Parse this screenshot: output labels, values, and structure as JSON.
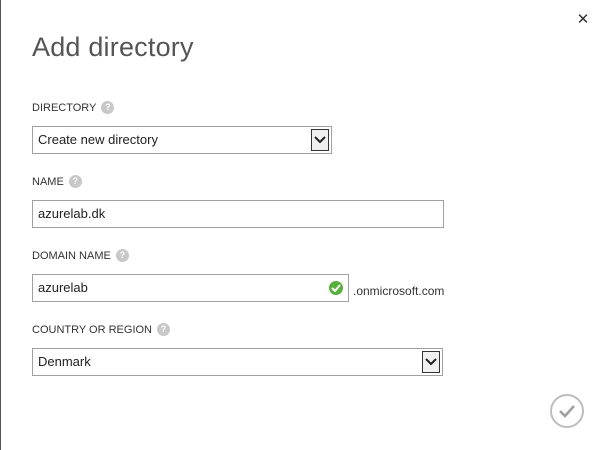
{
  "dialog": {
    "title": "Add directory",
    "close_icon": "close-icon",
    "confirm_icon": "checkmark-icon"
  },
  "directory": {
    "label": "DIRECTORY",
    "help": "?",
    "selected": "Create new directory"
  },
  "name": {
    "label": "NAME",
    "help": "?",
    "value": "azurelab.dk"
  },
  "domain": {
    "label": "DOMAIN NAME",
    "help": "?",
    "value": "azurelab",
    "suffix": ".onmicrosoft.com",
    "status_icon": "valid-check-icon"
  },
  "country": {
    "label": "COUNTRY OR REGION",
    "help": "?",
    "selected": "Denmark"
  },
  "colors": {
    "valid": "#56b13a",
    "title": "#555555"
  }
}
